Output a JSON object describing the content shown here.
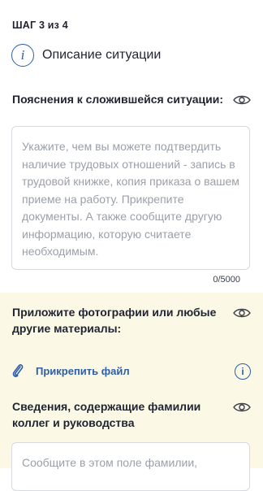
{
  "step": "ШАГ 3 из 4",
  "section_title": "Описание ситуации",
  "explanation": {
    "label": "Пояснения к сложившейся ситуации:",
    "placeholder": "Укажите, чем вы можете подтвердить наличие трудовых отношений - запись в трудовой книжке, копия приказа о вашем приеме на работу. Прикрепите документы. А также сообщите другую информацию, которую считаете необходимым.",
    "counter": "0/5000"
  },
  "attachments": {
    "label": "Приложите фотографии или любые другие материалы:",
    "attach_label": "Прикрепить файл"
  },
  "colleagues": {
    "label": "Сведения, содержащие фамилии коллег и руководства",
    "placeholder": "Сообщите в этом поле фамилии,"
  },
  "colors": {
    "accent": "#2d5ea8",
    "yellow_bg": "#fbf8e6"
  },
  "icons": [
    "info-icon",
    "eye-icon",
    "paperclip-icon",
    "info-small-icon"
  ]
}
